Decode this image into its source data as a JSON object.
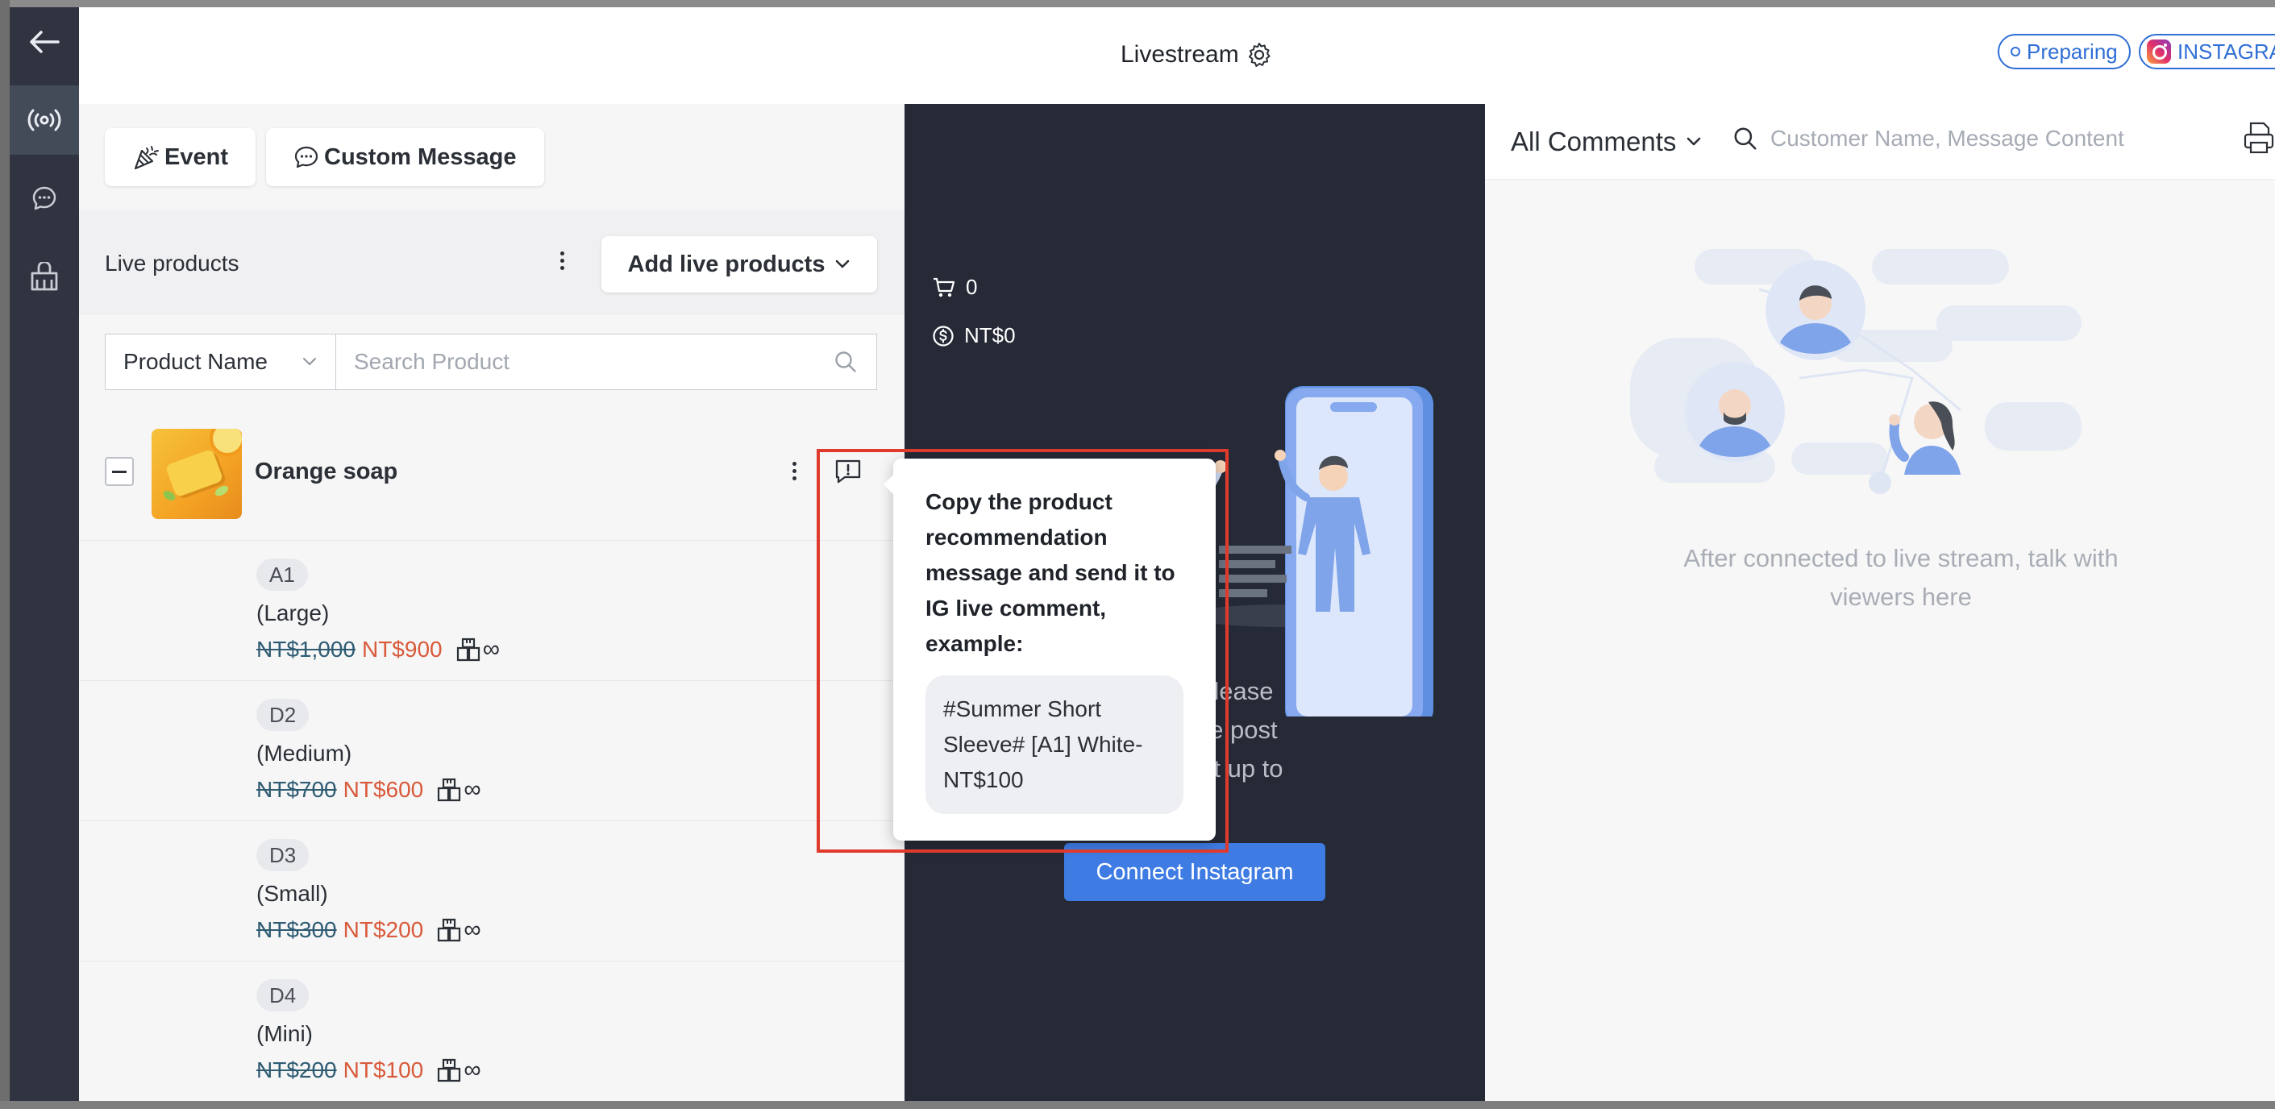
{
  "header": {
    "title": "Livestream",
    "status": "Preparing",
    "platform": "INSTAGRAM"
  },
  "toolbar": {
    "event_label": "Event",
    "custom_message_label": "Custom Message"
  },
  "live_products": {
    "title": "Live products",
    "add_label": "Add live products",
    "filter_selected": "Product Name",
    "search_placeholder": "Search Product",
    "product": {
      "name": "Orange soap"
    },
    "variants": [
      {
        "code": "A1",
        "size": "(Large)",
        "old_price": "NT$1,000",
        "price": "NT$900",
        "stock": "∞"
      },
      {
        "code": "D2",
        "size": "(Medium)",
        "old_price": "NT$700",
        "price": "NT$600",
        "stock": "∞"
      },
      {
        "code": "D3",
        "size": "(Small)",
        "old_price": "NT$300",
        "price": "NT$200",
        "stock": "∞"
      },
      {
        "code": "D4",
        "size": "(Mini)",
        "old_price": "NT$200",
        "price": "NT$100",
        "stock": "∞"
      }
    ]
  },
  "stream": {
    "cart_count": "0",
    "revenue": "NT$0",
    "visible_text": "ram Live, please\nnnect to live post\nlive can last up to\nur.",
    "connect_label": "Connect Instagram"
  },
  "comments": {
    "filter_label": "All Comments",
    "search_placeholder": "Customer Name, Message Content",
    "empty_text": "After connected to live stream, talk with viewers here"
  },
  "tooltip": {
    "text": "Copy the product recommendation message and send it to IG live comment, example:",
    "example": "#Summer Short Sleeve# [A1] White-NT$100"
  },
  "colors": {
    "accent": "#3e7ce3",
    "nav_bg": "#2f3440",
    "stream_bg": "#252a36",
    "sale_price": "#d85a3a",
    "highlight": "#e03a2c"
  },
  "icons": [
    "back-arrow-icon",
    "broadcast-icon",
    "chat-icon",
    "shop-icon",
    "gear-icon",
    "party-popper-icon",
    "message-icon",
    "chevron-down-icon",
    "search-icon",
    "cart-icon",
    "dollar-icon",
    "message-info-icon",
    "stock-icon",
    "printer-icon"
  ]
}
